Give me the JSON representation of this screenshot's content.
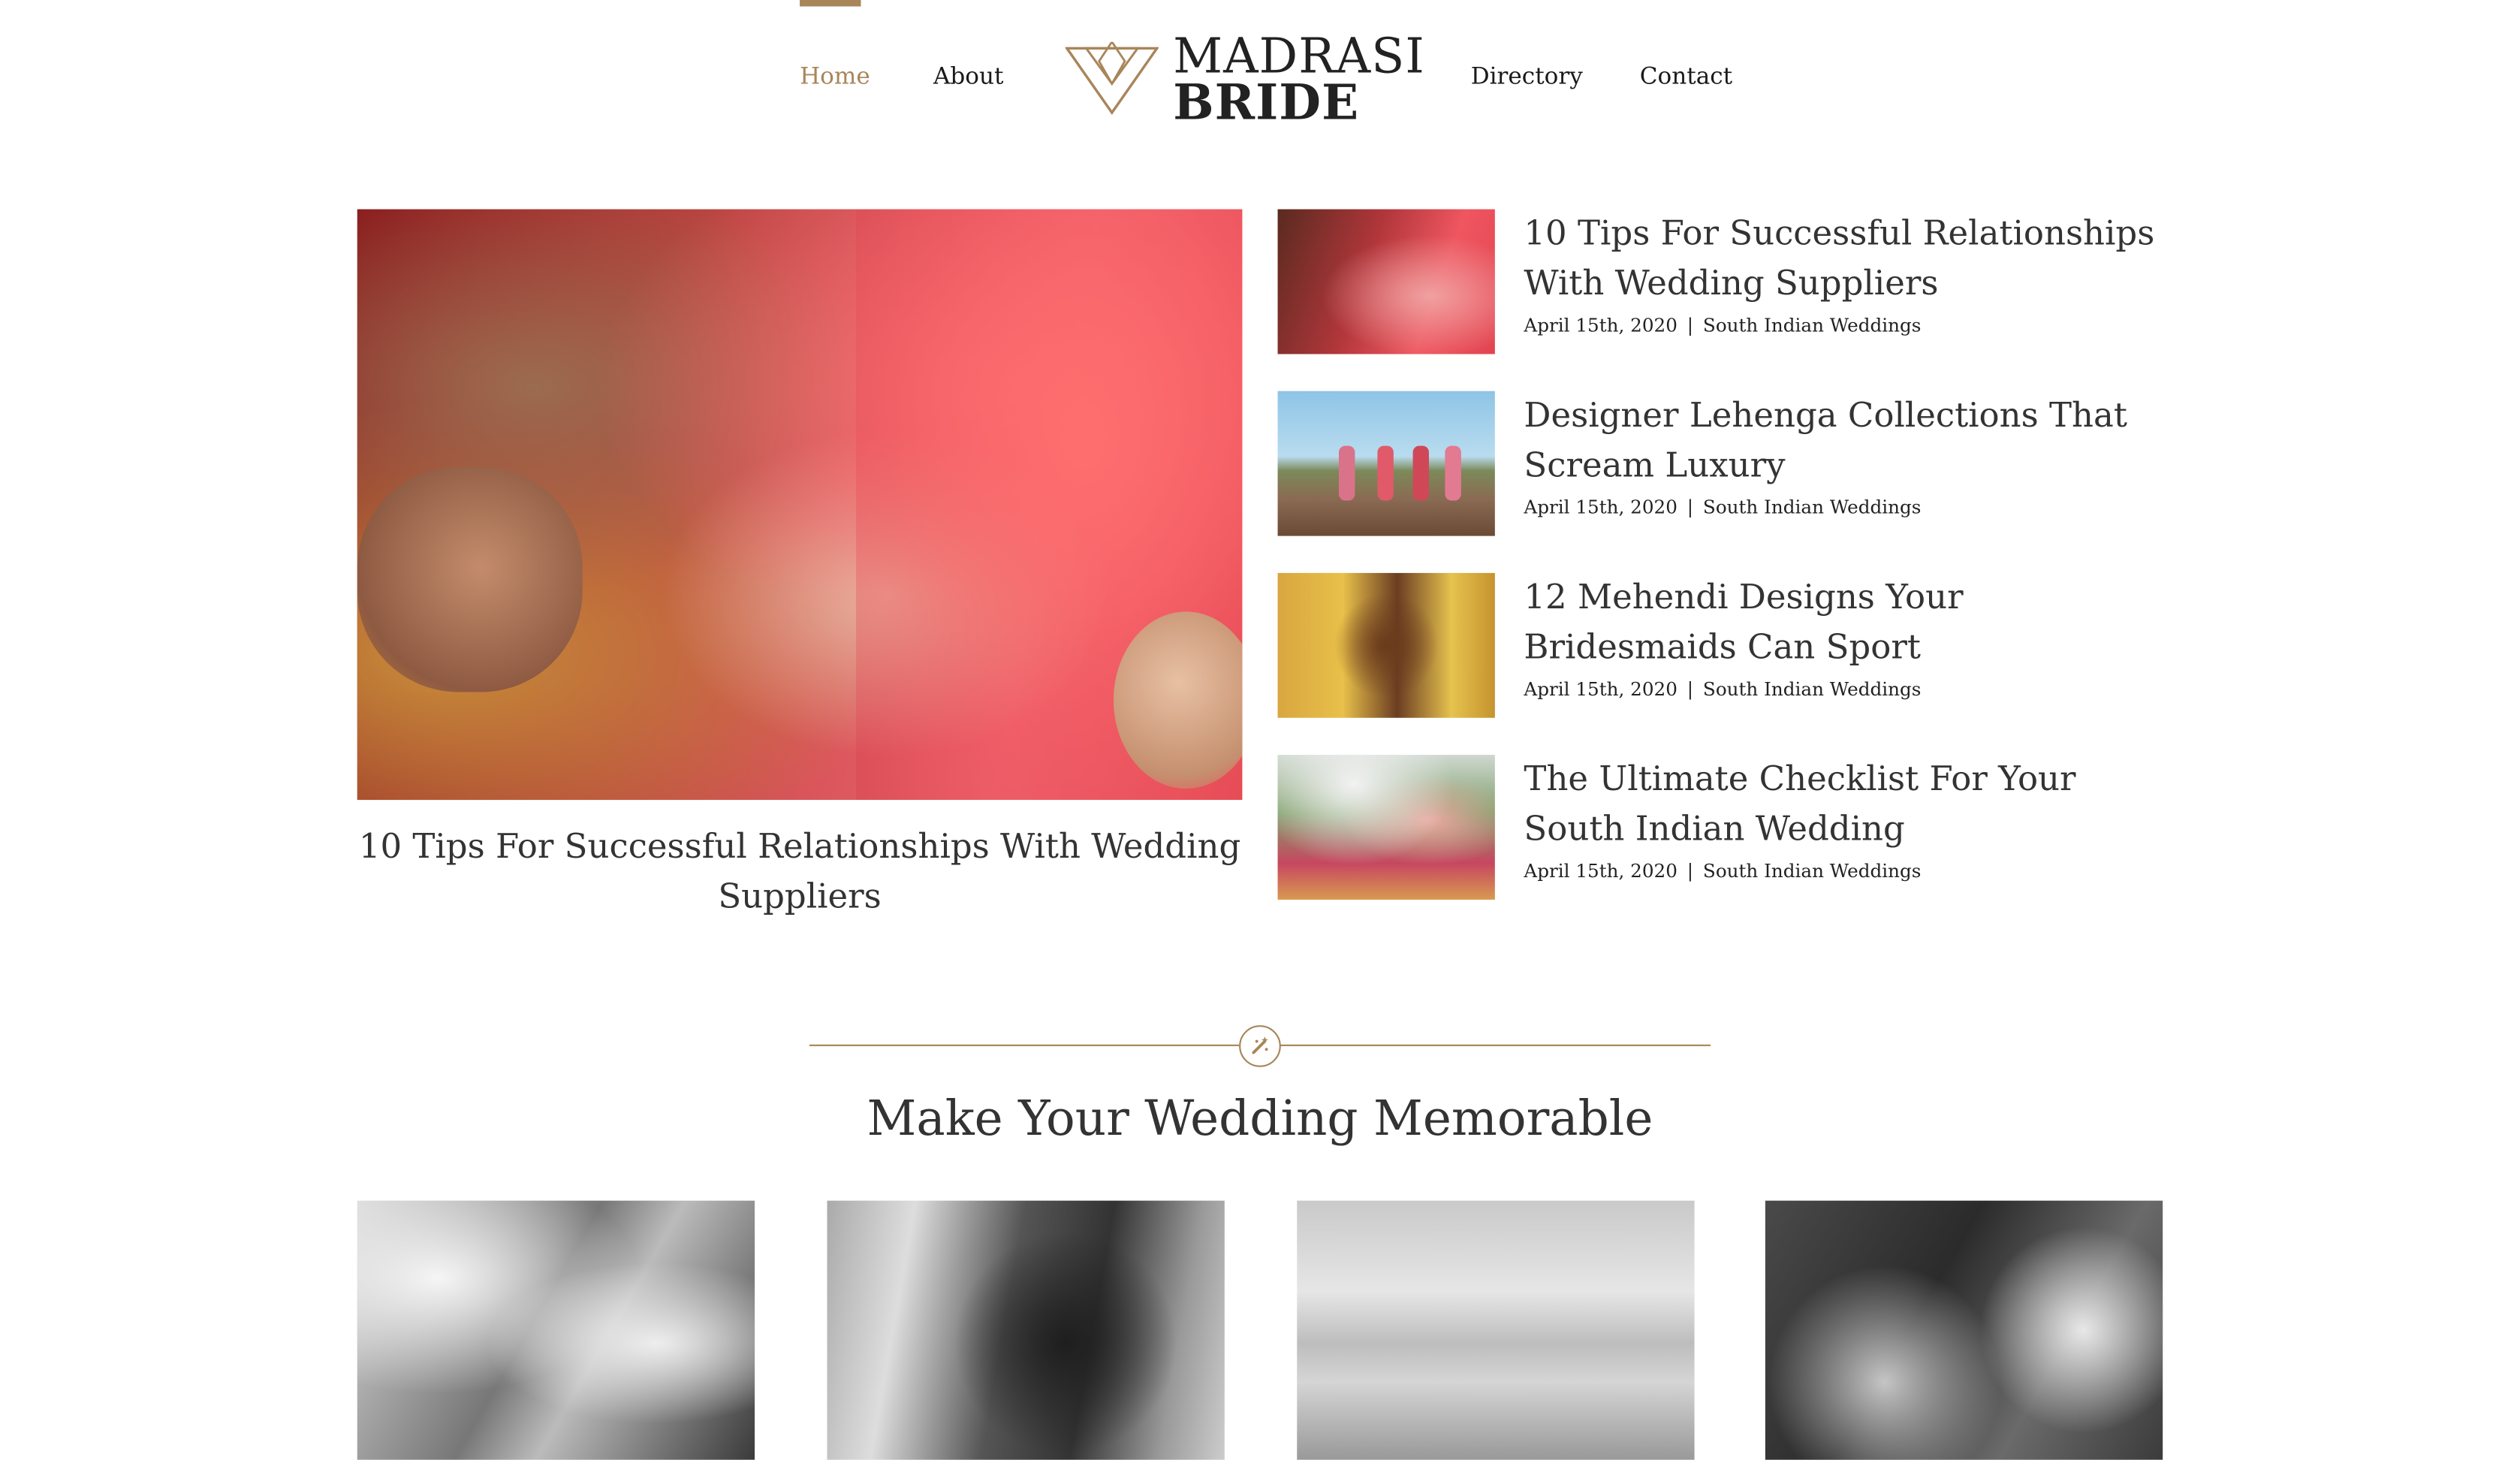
{
  "nav": {
    "items": [
      {
        "label": "Home",
        "active": true
      },
      {
        "label": "About"
      },
      {
        "label": "Directory"
      },
      {
        "label": "Contact"
      }
    ],
    "logo": {
      "line1": "MADRASI",
      "line2": "BRIDE"
    }
  },
  "featured": {
    "title": "10 Tips For Successful Relationships With Wedding Suppliers",
    "image_icon": "wedding-ceremony-photo"
  },
  "posts": [
    {
      "title": "10 Tips For Successful Relationships With Wedding Suppliers",
      "date": "April 15th, 2020",
      "separator": "|",
      "category": "South Indian Weddings"
    },
    {
      "title": "Designer Lehenga Collections That Scream Luxury",
      "date": "April 15th, 2020",
      "separator": "|",
      "category": "South Indian Weddings"
    },
    {
      "title": "12 Mehendi Designs Your Bridesmaids Can Sport",
      "date": "April 15th, 2020",
      "separator": "|",
      "category": "South Indian Weddings"
    },
    {
      "title": "The Ultimate Checklist For Your South Indian Wedding",
      "date": "April 15th, 2020",
      "separator": "|",
      "category": "South Indian Weddings"
    }
  ],
  "section": {
    "divider_icon": "magic-wand-icon",
    "title": "Make Your Wedding Memorable"
  },
  "colors": {
    "accent": "#a8865a",
    "text": "#333333",
    "nav_text": "#1a1a1a"
  }
}
